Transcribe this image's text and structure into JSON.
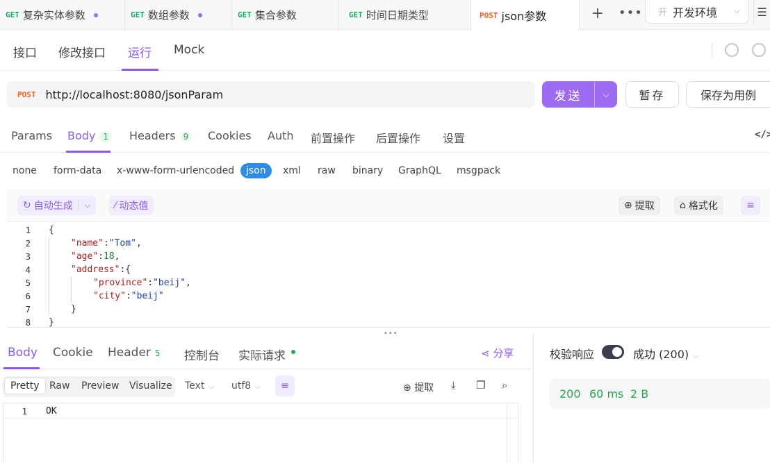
{
  "tabs": [
    {
      "method": "GET",
      "name": "复杂实体参数",
      "modified": true
    },
    {
      "method": "GET",
      "name": "数组参数",
      "modified": true
    },
    {
      "method": "GET",
      "name": "集合参数",
      "modified": false
    },
    {
      "method": "GET",
      "name": "时间日期类型",
      "modified": false
    },
    {
      "method": "POST",
      "name": "json参数",
      "modified": false,
      "active": true
    }
  ],
  "environment": {
    "badge": "开",
    "name": "开发环境"
  },
  "subtabs": [
    "接口",
    "修改接口",
    "运行",
    "Mock"
  ],
  "subtab_active": "运行",
  "request": {
    "method": "POST",
    "url": "http://localhost:8080/jsonParam",
    "send_label": "发送",
    "save_label": "暂存",
    "save_case_label": "保存为用例"
  },
  "request_tabs": [
    {
      "label": "Params"
    },
    {
      "label": "Body",
      "count": "1"
    },
    {
      "label": "Headers",
      "count": "9"
    },
    {
      "label": "Cookies"
    },
    {
      "label": "Auth"
    },
    {
      "label": "前置操作"
    },
    {
      "label": "后置操作"
    },
    {
      "label": "设置"
    }
  ],
  "code_toggle": "</>",
  "body_types": [
    "none",
    "form-data",
    "x-www-form-urlencoded",
    "json",
    "xml",
    "raw",
    "binary",
    "GraphQL",
    "msgpack"
  ],
  "body_type_active": "json",
  "editor_toolbar": {
    "auto_generate": "自动生成",
    "dynamic_value": "动态值",
    "extract": "提取",
    "format": "格式化"
  },
  "code_lines": [
    {
      "n": "1",
      "indent": 0,
      "tokens": [
        [
          "p",
          "{"
        ]
      ]
    },
    {
      "n": "2",
      "indent": 1,
      "tokens": [
        [
          "k",
          "\"name\""
        ],
        [
          "p",
          ":"
        ],
        [
          "s",
          "\"Tom\""
        ],
        [
          "p",
          ","
        ]
      ]
    },
    {
      "n": "3",
      "indent": 1,
      "tokens": [
        [
          "k",
          "\"age\""
        ],
        [
          "p",
          ":"
        ],
        [
          "n",
          "18"
        ],
        [
          "p",
          ","
        ]
      ]
    },
    {
      "n": "4",
      "indent": 1,
      "tokens": [
        [
          "k",
          "\"address\""
        ],
        [
          "p",
          ":{"
        ]
      ]
    },
    {
      "n": "5",
      "indent": 2,
      "tokens": [
        [
          "k",
          "\"province\""
        ],
        [
          "p",
          ":"
        ],
        [
          "s",
          "\"beij\""
        ],
        [
          "p",
          ","
        ]
      ]
    },
    {
      "n": "6",
      "indent": 2,
      "tokens": [
        [
          "k",
          "\"city\""
        ],
        [
          "p",
          ":"
        ],
        [
          "s",
          "\"beij\""
        ]
      ]
    },
    {
      "n": "7",
      "indent": 1,
      "tokens": [
        [
          "p",
          "}"
        ]
      ]
    },
    {
      "n": "8",
      "indent": 0,
      "tokens": [
        [
          "p",
          "}"
        ]
      ]
    }
  ],
  "response_tabs": [
    {
      "label": "Body"
    },
    {
      "label": "Cookie"
    },
    {
      "label": "Header",
      "count": "5"
    },
    {
      "label": "控制台"
    },
    {
      "label": "实际请求",
      "dot": true
    }
  ],
  "share_label": "分享",
  "response_formats": [
    "Pretty",
    "Raw",
    "Preview",
    "Visualize"
  ],
  "response_format_active": "Pretty",
  "response_type": "Text",
  "response_encoding": "utf8",
  "response_extract": "提取",
  "response_lines": [
    {
      "n": "1",
      "text": "OK"
    }
  ],
  "validate": {
    "label": "校验响应",
    "enabled": true,
    "status": "成功 (200)"
  },
  "stats": {
    "status": "200",
    "time": "60 ms",
    "size": "2 B"
  },
  "colors": {
    "accent": "#8a5cf0",
    "send": "#9b6cf0",
    "get": "#1aa867",
    "post": "#f5631f",
    "success": "#2da44e",
    "json_active": "#2f8be6"
  }
}
